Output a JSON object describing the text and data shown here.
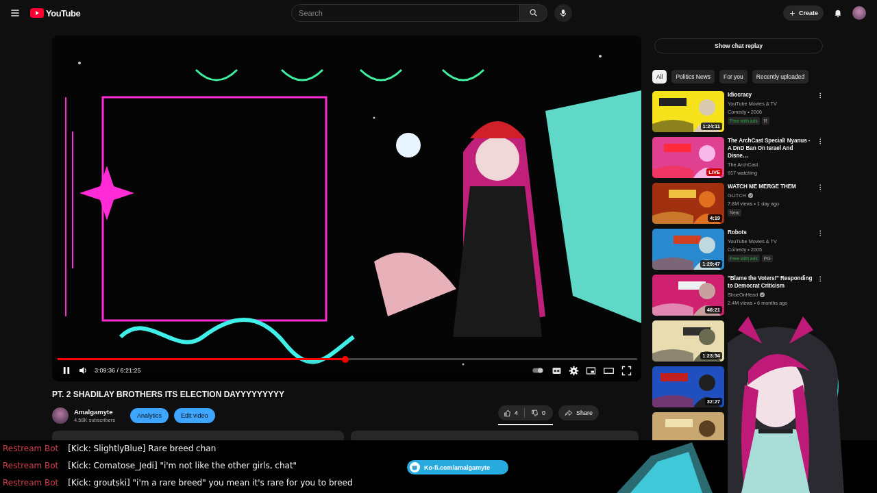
{
  "header": {
    "logo": "YouTube",
    "search": {
      "placeholder": "Search"
    },
    "create": "Create"
  },
  "player": {
    "playing": true,
    "level": 0.497,
    "time": "3:09:36 / 6:21:25"
  },
  "video": {
    "title": "PT. 2 SHADILAY BROTHERS ITS ELECTION DAYYYYYYYYY",
    "channel": "Amalgamyte",
    "subscribers": "4.58K subscribers",
    "buttons": [
      "Analytics",
      "Edit video"
    ],
    "likes": "4",
    "dislikes": "0",
    "share": "Share"
  },
  "sidebar": {
    "chat_button": "Show chat replay",
    "chips": [
      {
        "label": "All",
        "selected": true
      },
      {
        "label": "Politics News",
        "selected": false
      },
      {
        "label": "For you",
        "selected": false
      },
      {
        "label": "Recently uploaded",
        "selected": false
      }
    ],
    "videos": [
      {
        "title": "Idiocracy",
        "channel": "YouTube Movies & TV",
        "verified": false,
        "meta": "Comedy • 2006",
        "badges": [
          {
            "label": "Free with ads",
            "kind": "free"
          },
          {
            "label": "R",
            "kind": "rating"
          }
        ],
        "thumb_label": {
          "text": "1:24:11",
          "kind": "duration"
        }
      },
      {
        "title": "The ArchCast Special! Nyanus - A DnD Ban On Israel And Disne…",
        "channel": "The ArchCast",
        "verified": false,
        "meta": "917 watching",
        "thumb_label": {
          "text": "LIVE",
          "kind": "live"
        }
      },
      {
        "title": "WATCH ME MERGE THEM",
        "channel": "GLITCH",
        "verified": true,
        "meta": "7.8M views • 1 day ago",
        "badges": [
          {
            "label": "New",
            "kind": "plain"
          }
        ],
        "thumb_label": {
          "text": "4:19",
          "kind": "duration"
        }
      },
      {
        "title": "Robots",
        "channel": "YouTube Movies & TV",
        "verified": false,
        "meta": "Comedy • 2005",
        "badges": [
          {
            "label": "Free with ads",
            "kind": "free"
          },
          {
            "label": "PG",
            "kind": "rating"
          }
        ],
        "thumb_label": {
          "text": "1:29:47",
          "kind": "duration"
        }
      },
      {
        "title": "\"Blame the Voters!\" Responding to Democrat Criticism",
        "channel": "ShoeOnHead",
        "verified": true,
        "meta": "2.4M views • 6 months ago",
        "thumb_label": {
          "text": "46:21",
          "kind": "duration"
        }
      },
      {
        "thumb_label": {
          "text": "1:23:54",
          "kind": "duration"
        }
      },
      {
        "thumb_label": {
          "text": "32:27",
          "kind": "duration"
        }
      },
      {
        "kind": "picture"
      }
    ]
  },
  "chat_overlay": {
    "messages": [
      {
        "author": "Restream Bot",
        "message": "[Kick: SlightlyBlue] Rare breed chan"
      },
      {
        "author": "Restream Bot",
        "message": "[Kick: Comatose_Jedi] \"i'm not like the other girls, chat\""
      },
      {
        "author": "Restream Bot",
        "message": "[Kick: groutski] \"i'm a rare breed\" you mean it's rare for you to breed"
      }
    ],
    "kofi": "Ko-fi.com/amalgamyte"
  }
}
